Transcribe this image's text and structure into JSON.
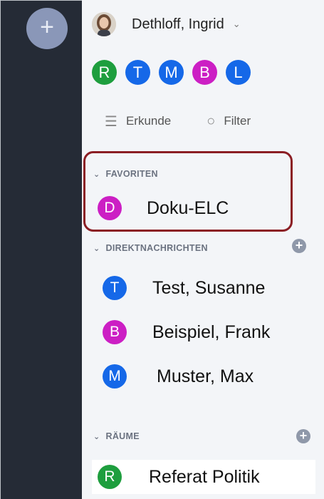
{
  "rail": {
    "add_label": "+"
  },
  "user": {
    "name": "Dethloff, Ingrid",
    "chevron": "⌄"
  },
  "favorite_avatars": [
    {
      "letter": "R",
      "color": "#1e9e3e"
    },
    {
      "letter": "T",
      "color": "#1568e8"
    },
    {
      "letter": "M",
      "color": "#1568e8"
    },
    {
      "letter": "B",
      "color": "#cc1fc4"
    },
    {
      "letter": "L",
      "color": "#1568e8"
    }
  ],
  "toolbar": {
    "explore_label": "Erkunde",
    "filter_label": "Filter"
  },
  "favorites": {
    "heading": "FAVORITEN",
    "items": [
      {
        "letter": "D",
        "label": "Doku-ELC",
        "color": "#cc1fc4"
      }
    ]
  },
  "direct_messages": {
    "heading": "DIREKTNACHRICHTEN",
    "items": [
      {
        "letter": "T",
        "label": "Test, Susanne",
        "color": "#1568e8"
      },
      {
        "letter": "B",
        "label": "Beispiel, Frank",
        "color": "#cc1fc4"
      },
      {
        "letter": "M",
        "label": "Muster, Max",
        "color": "#1568e8"
      }
    ]
  },
  "rooms": {
    "heading": "RÄUME",
    "items": [
      {
        "letter": "R",
        "label": "Referat Politik",
        "color": "#1e9e3e"
      }
    ]
  },
  "highlight_color": "#8b1e24"
}
